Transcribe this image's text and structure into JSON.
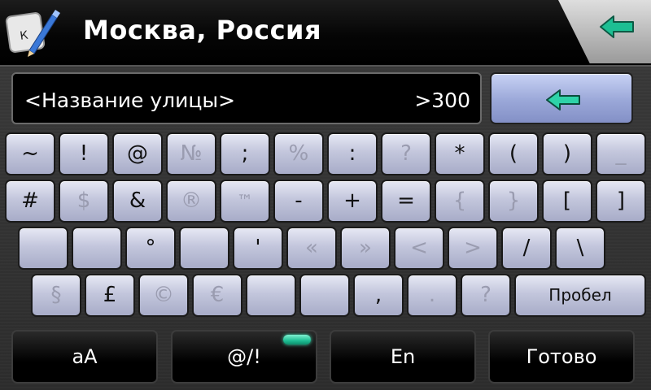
{
  "header": {
    "title": "Москва, Россия",
    "app_icon_letter": "К",
    "back_icon": "back-arrow-icon"
  },
  "search": {
    "value": "<Название улицы>",
    "count": ">300",
    "backspace_icon": "backspace-arrow-icon"
  },
  "keyboard": {
    "row1": [
      "~",
      "!",
      "@",
      "№",
      ";",
      "%",
      ":",
      "?",
      "*",
      "(",
      ")",
      "_"
    ],
    "row2": [
      "#",
      "$",
      "&",
      "®",
      "™",
      "-",
      "+",
      "=",
      "{",
      "}",
      "[",
      "]"
    ],
    "row3": [
      "",
      "",
      "°",
      "",
      "'",
      "«",
      "»",
      "<",
      ">",
      "/",
      "\\"
    ],
    "row4": [
      "§",
      "£",
      "©",
      "€",
      "",
      "",
      ",",
      ".",
      "?"
    ],
    "space_label": "Пробел"
  },
  "bottom_bar": {
    "case_label": "aA",
    "symbols_label": "@/!",
    "language_label": "En",
    "done_label": "Готово"
  },
  "colors": {
    "accent": "#2ed3a8",
    "key_face": "#c3c6dc",
    "backspace_face": "#9aa7d8"
  }
}
